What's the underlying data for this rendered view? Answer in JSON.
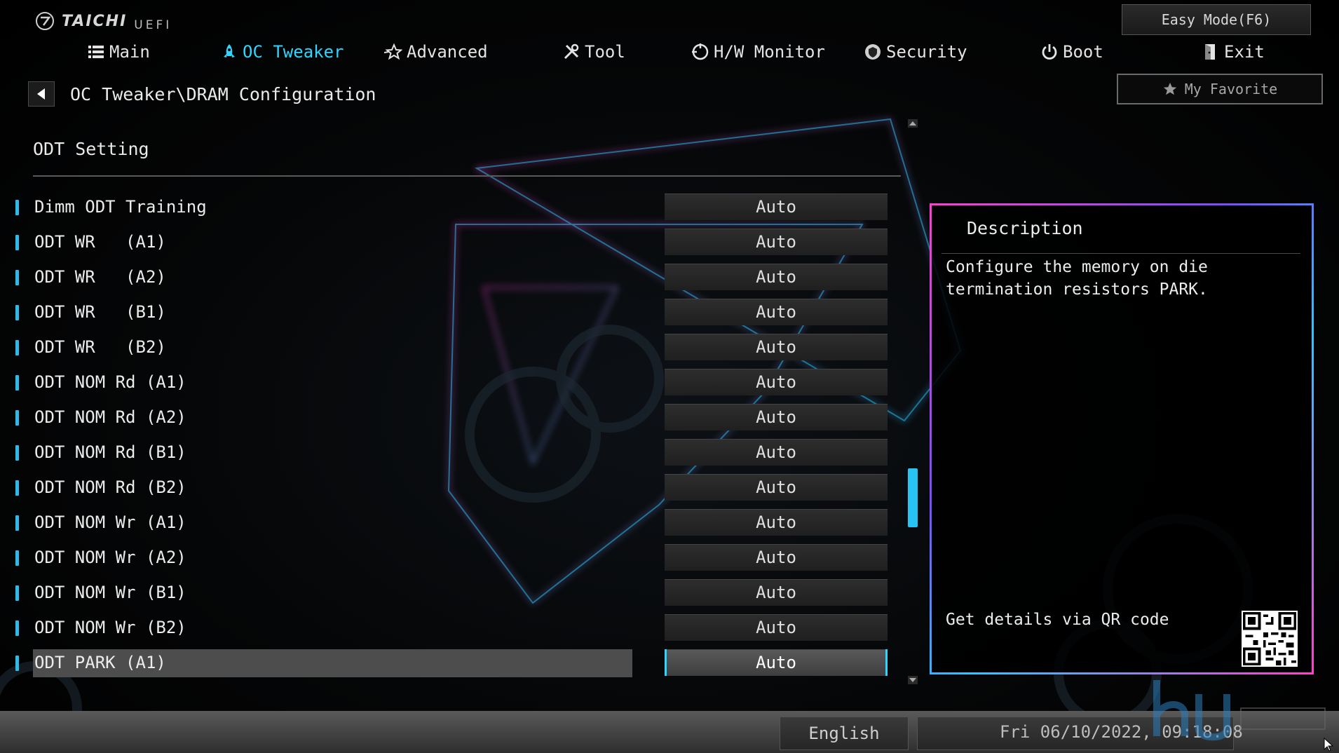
{
  "brand": {
    "name": "TAICHI",
    "sub": "UEFI"
  },
  "easy_mode_label": "Easy Mode(F6)",
  "favorite_label": "My Favorite",
  "tabs": [
    {
      "label": "Main",
      "icon": "list-icon"
    },
    {
      "label": "OC Tweaker",
      "icon": "rocket-icon"
    },
    {
      "label": "Advanced",
      "icon": "star-icon"
    },
    {
      "label": "Tool",
      "icon": "tools-icon"
    },
    {
      "label": "H/W Monitor",
      "icon": "monitor-icon"
    },
    {
      "label": "Security",
      "icon": "shield-icon"
    },
    {
      "label": "Boot",
      "icon": "power-icon"
    },
    {
      "label": "Exit",
      "icon": "exit-icon"
    }
  ],
  "active_tab": "OC Tweaker",
  "breadcrumb": "OC Tweaker\\DRAM Configuration",
  "section_title": "ODT Setting",
  "settings": [
    {
      "label": "Dimm ODT Training",
      "value": "Auto"
    },
    {
      "label": "ODT WR   (A1)",
      "value": "Auto"
    },
    {
      "label": "ODT WR   (A2)",
      "value": "Auto"
    },
    {
      "label": "ODT WR   (B1)",
      "value": "Auto"
    },
    {
      "label": "ODT WR   (B2)",
      "value": "Auto"
    },
    {
      "label": "ODT NOM Rd (A1)",
      "value": "Auto"
    },
    {
      "label": "ODT NOM Rd (A2)",
      "value": "Auto"
    },
    {
      "label": "ODT NOM Rd (B1)",
      "value": "Auto"
    },
    {
      "label": "ODT NOM Rd (B2)",
      "value": "Auto"
    },
    {
      "label": "ODT NOM Wr (A1)",
      "value": "Auto"
    },
    {
      "label": "ODT NOM Wr (A2)",
      "value": "Auto"
    },
    {
      "label": "ODT NOM Wr (B1)",
      "value": "Auto"
    },
    {
      "label": "ODT NOM Wr (B2)",
      "value": "Auto"
    },
    {
      "label": "ODT PARK (A1)",
      "value": "Auto",
      "selected": true
    }
  ],
  "description": {
    "title": "Description",
    "text": "Configure the memory on die\ntermination resistors PARK.",
    "qr_label": "Get details via QR code"
  },
  "status": {
    "language": "English",
    "datetime": "Fri 06/10/2022, 09:18:08"
  },
  "colors": {
    "accent": "#2fd4ff",
    "panel_border_pink": "#ff3fd0",
    "panel_border_blue": "#29c8ff"
  }
}
